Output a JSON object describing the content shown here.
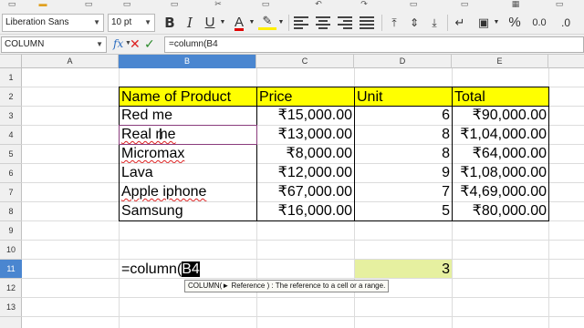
{
  "toolbar": {
    "font_name": "Liberation Sans",
    "font_size": "10 pt",
    "bold_label": "B",
    "italic_label": "I",
    "underline_label": "U",
    "font_color_label": "A",
    "percent_label": "%",
    "decimal_label": "0.0",
    "icons": [
      "bold-icon",
      "italic-icon",
      "underline-icon",
      "font-color-icon",
      "highlight-icon",
      "align-left-icon",
      "align-center-icon",
      "align-right-icon",
      "justify-icon",
      "align-top-icon",
      "align-middle-icon",
      "align-bottom-icon",
      "number-format-icon",
      "percent-icon",
      "decimal-icon"
    ]
  },
  "formula_bar": {
    "name_box": "COLUMN",
    "fx_label": "fx",
    "formula": "=column(B4"
  },
  "columns": [
    "A",
    "B",
    "C",
    "D",
    "E"
  ],
  "active_column": "B",
  "rows": [
    "1",
    "2",
    "3",
    "4",
    "5",
    "6",
    "7",
    "8",
    "9",
    "10",
    "11",
    "12",
    "13"
  ],
  "active_row": "11",
  "table": {
    "header": [
      "Name of Product",
      "Price",
      "Unit",
      "Total"
    ],
    "rows": [
      [
        "Red me",
        "₹15,000.00",
        "6",
        "₹90,000.00"
      ],
      [
        "Real me",
        "₹13,000.00",
        "8",
        "₹1,04,000.00"
      ],
      [
        "Micromax",
        "₹8,000.00",
        "8",
        "₹64,000.00"
      ],
      [
        "Lava",
        "₹12,000.00",
        "9",
        "₹1,08,000.00"
      ],
      [
        "Apple iphone",
        "₹67,000.00",
        "7",
        "₹4,69,000.00"
      ],
      [
        "Samsung",
        "₹16,000.00",
        "5",
        "₹80,000.00"
      ]
    ]
  },
  "edit_cell": {
    "prefix": "=column(",
    "reference": "B4"
  },
  "result_cell": "3",
  "tooltip": "COLUMN(► Reference ) : The reference to a cell or a range.",
  "colors": {
    "header_fill": "#ffff00",
    "active_header": "#4a86d0",
    "result_fill": "#e6f0a0",
    "selection_border": "#8a3c7c"
  }
}
